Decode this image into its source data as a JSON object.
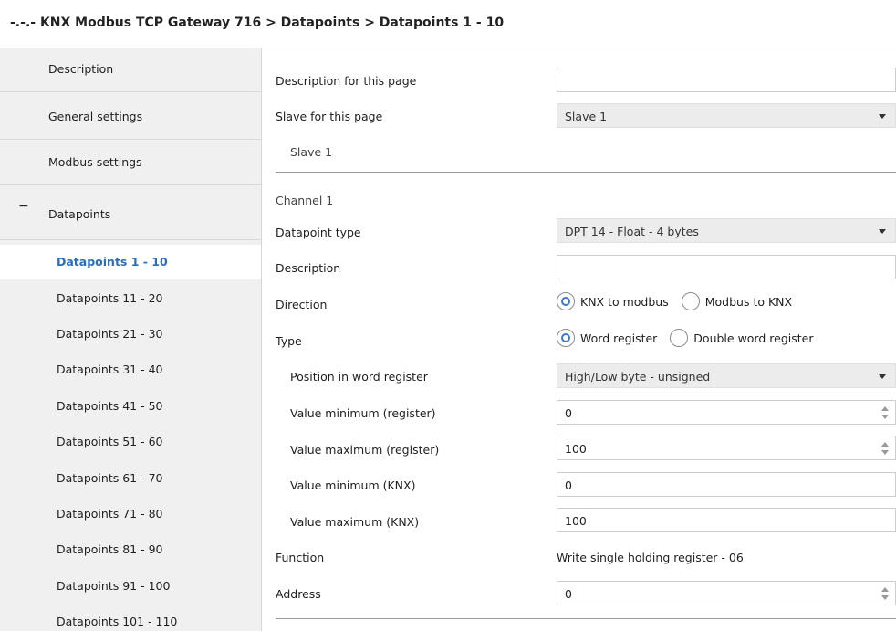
{
  "title": "-.-.- KNX Modbus TCP Gateway 716 > Datapoints > Datapoints 1 - 10",
  "sidebar": {
    "items": [
      {
        "label": "Description"
      },
      {
        "label": "General settings"
      },
      {
        "label": "Modbus settings"
      },
      {
        "label": "Datapoints",
        "expander": "−"
      }
    ],
    "subitems": [
      {
        "label": "Datapoints 1 - 10",
        "active": true
      },
      {
        "label": "Datapoints 11 - 20"
      },
      {
        "label": "Datapoints 21 - 30"
      },
      {
        "label": "Datapoints 31 - 40"
      },
      {
        "label": "Datapoints 41 - 50"
      },
      {
        "label": "Datapoints 51 - 60"
      },
      {
        "label": "Datapoints 61 - 70"
      },
      {
        "label": "Datapoints 71 - 80"
      },
      {
        "label": "Datapoints 81 - 90"
      },
      {
        "label": "Datapoints 91 - 100"
      },
      {
        "label": "Datapoints 101 - 110"
      }
    ]
  },
  "form": {
    "desc_page_label": "Description for this page",
    "desc_page_value": "",
    "slave_label": "Slave for this page",
    "slave_value": "Slave 1",
    "slave_heading": "Slave 1",
    "channel_heading": "Channel 1",
    "dpt_label": "Datapoint type",
    "dpt_value": "DPT 14 - Float - 4 bytes",
    "description_label": "Description",
    "description_value": "",
    "direction_label": "Direction",
    "direction_options": [
      "KNX to modbus",
      "Modbus to KNX"
    ],
    "direction_selected": "KNX to modbus",
    "type_label": "Type",
    "type_options": [
      "Word register",
      "Double word register"
    ],
    "type_selected": "Word register",
    "position_label": "Position in word register",
    "position_value": "High/Low byte - unsigned",
    "vmin_reg_label": "Value minimum (register)",
    "vmin_reg_value": "0",
    "vmax_reg_label": "Value maximum (register)",
    "vmax_reg_value": "100",
    "vmin_knx_label": "Value minimum (KNX)",
    "vmin_knx_value": "0",
    "vmax_knx_label": "Value maximum (KNX)",
    "vmax_knx_value": "100",
    "function_label": "Function",
    "function_value": "Write single holding register - 06",
    "address_label": "Address",
    "address_value": "0"
  }
}
